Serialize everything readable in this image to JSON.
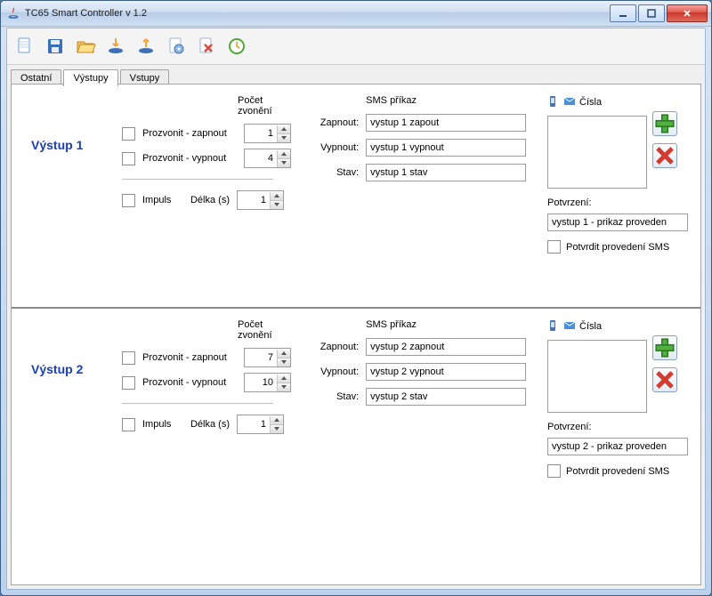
{
  "window": {
    "title": "TC65 Smart Controller v 1.2"
  },
  "tabs": [
    "Ostatní",
    "Výstupy",
    "Vstupy"
  ],
  "activeTab": 1,
  "labels": {
    "ringHeader": "Počet zvonění",
    "smsHeader": "SMS příkaz",
    "numbersHeader": "Čísla",
    "ringOn": "Prozvonit - zapnout",
    "ringOff": "Prozvonit - vypnout",
    "impulse": "Impuls",
    "length": "Délka (s)",
    "on": "Zapnout:",
    "off": "Vypnout:",
    "state": "Stav:",
    "confirm": "Potvrzení:",
    "confirmSms": "Potvrdit provedení SMS"
  },
  "outputs": [
    {
      "title": "Výstup 1",
      "ringOn": 1,
      "ringOff": 4,
      "impulseLen": 1,
      "smsOn": "vystup 1 zapout",
      "smsOff": "vystup 1 vypnout",
      "smsState": "vystup 1 stav",
      "confirmText": "vystup 1 - prikaz proveden"
    },
    {
      "title": "Výstup 2",
      "ringOn": 7,
      "ringOff": 10,
      "impulseLen": 1,
      "smsOn": "vystup 2 zapnout",
      "smsOff": "vystup 2 vypnout",
      "smsState": "vystup 2 stav",
      "confirmText": "vystup 2 - prikaz proveden"
    }
  ]
}
